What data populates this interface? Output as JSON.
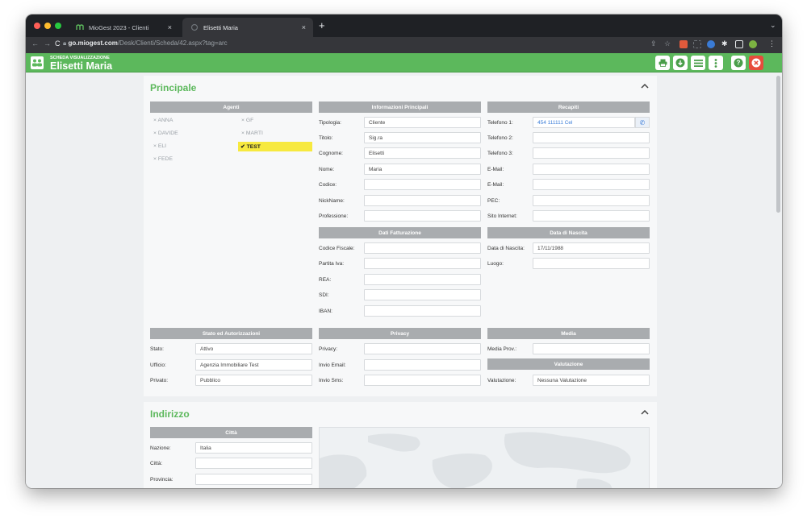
{
  "browser": {
    "tabs": [
      {
        "label": "MioGest 2023 - Clienti",
        "close": "×"
      },
      {
        "label": "Elisetti Maria",
        "close": "×"
      }
    ],
    "new_tab": "+",
    "url_domain": "go.miogest.com",
    "url_path": "/Desk/Clienti/Scheda/42.aspx?tag=arc",
    "menu": "⌄"
  },
  "app": {
    "subtitle": "SCHEDA VISUALIZZAZIONE",
    "title": "Elisetti Maria",
    "accent": "#5cb85c"
  },
  "principale": {
    "title": "Principale",
    "agenti": {
      "header": "Agenti",
      "left": [
        "ANNA",
        "DAVIDE",
        "ELI",
        "FEDE"
      ],
      "right": [
        "GF",
        "MARTI",
        "TEST"
      ],
      "selected": "TEST"
    },
    "info": {
      "header": "Informazioni Principali",
      "rows": [
        {
          "label": "Tipologia:",
          "value": "Cliente"
        },
        {
          "label": "Titolo:",
          "value": "Sig.ra"
        },
        {
          "label": "Cognome:",
          "value": "Elisetti"
        },
        {
          "label": "Nome:",
          "value": "Maria"
        },
        {
          "label": "Codice:",
          "value": ""
        },
        {
          "label": "NickName:",
          "value": ""
        },
        {
          "label": "Professione:",
          "value": ""
        }
      ]
    },
    "recapiti": {
      "header": "Recapiti",
      "rows": [
        {
          "label": "Telefono 1:",
          "value": "454 111111 Cel"
        },
        {
          "label": "Telefono 2:",
          "value": ""
        },
        {
          "label": "Telefono 3:",
          "value": ""
        },
        {
          "label": "E-Mail:",
          "value": ""
        },
        {
          "label": "E-Mail:",
          "value": ""
        },
        {
          "label": "PEC:",
          "value": ""
        },
        {
          "label": "Sito Internet:",
          "value": ""
        }
      ]
    },
    "fatturazione": {
      "header": "Dati Fatturazione",
      "rows": [
        {
          "label": "Codice Fiscale:",
          "value": ""
        },
        {
          "label": "Partita Iva:",
          "value": ""
        },
        {
          "label": "REA:",
          "value": ""
        },
        {
          "label": "SDI:",
          "value": ""
        },
        {
          "label": "IBAN:",
          "value": ""
        }
      ]
    },
    "nascita": {
      "header": "Data di Nascita",
      "rows": [
        {
          "label": "Data di Nascita:",
          "value": "17/11/1988"
        },
        {
          "label": "Luogo:",
          "value": ""
        }
      ]
    },
    "stato": {
      "header": "Stato ed Autorizzazioni",
      "rows": [
        {
          "label": "Stato:",
          "value": "Attivo"
        },
        {
          "label": "Ufficio:",
          "value": "Agenzia Immobiliare Test"
        },
        {
          "label": "Privato:",
          "value": "Pubblico"
        }
      ]
    },
    "privacy": {
      "header": "Privacy",
      "rows": [
        {
          "label": "Privacy:",
          "value": ""
        },
        {
          "label": "Invio Email:",
          "value": ""
        },
        {
          "label": "Invio Sms:",
          "value": ""
        }
      ]
    },
    "media": {
      "header": "Media",
      "rows": [
        {
          "label": "Media Prov.:",
          "value": ""
        }
      ]
    },
    "valutazione": {
      "header": "Valutazione",
      "rows": [
        {
          "label": "Valutazione:",
          "value": "Nessuna Valutazione"
        }
      ]
    }
  },
  "indirizzo": {
    "title": "Indirizzo",
    "citta": {
      "header": "Città",
      "rows": [
        {
          "label": "Nazione:",
          "value": "Italia"
        },
        {
          "label": "Città:",
          "value": ""
        },
        {
          "label": "Provincia:",
          "value": ""
        }
      ]
    }
  }
}
